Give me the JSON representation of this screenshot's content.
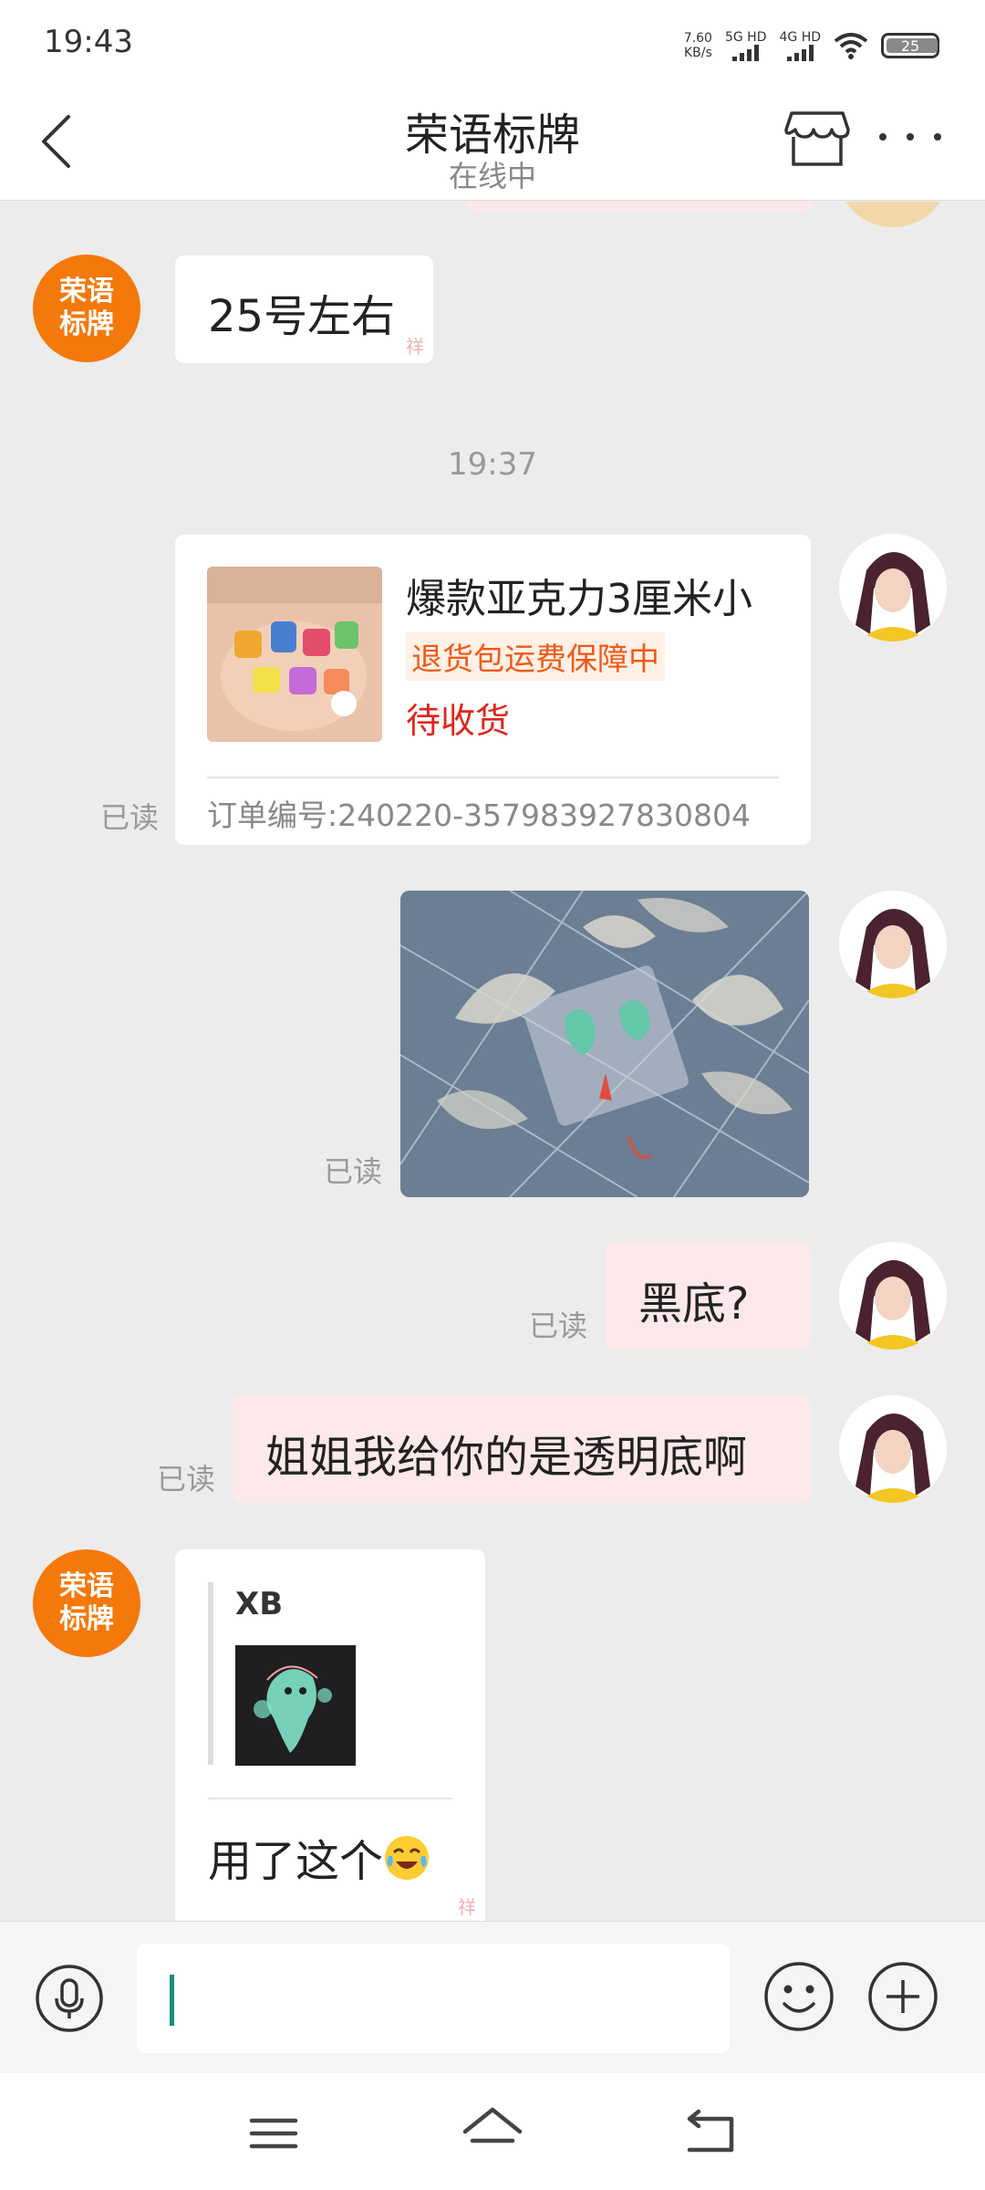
{
  "status_bar": {
    "time": "19:43",
    "speed_value": "7.60",
    "speed_unit": "KB/s",
    "sim1_label": "5G HD",
    "sim2_label": "4G HD",
    "battery": "25"
  },
  "header": {
    "title": "荣语标牌",
    "subtitle": "在线中"
  },
  "shop": {
    "avatar_text": "荣语\n标牌",
    "stamp_text": "祥"
  },
  "messages": {
    "m1_text": "25号左右",
    "timestamp": "19:37",
    "order": {
      "product_name": "爆款亚克力3厘米小",
      "tag": "退货包运费保障中",
      "status": "待收货",
      "order_no": "订单编号:240220-357983927830804"
    },
    "read_label": "已读",
    "m4_text": "黑底?",
    "m5_text": "姐姐我给你的是透明底啊",
    "quote_sender": "XB",
    "m6_text": "用了这个"
  },
  "icons": {
    "back": "chevron-left-icon",
    "shop": "store-icon",
    "more": "more-dots-icon",
    "mic": "microphone-icon",
    "emoji": "smiley-icon",
    "plus": "plus-circle-icon",
    "nav_menu": "menu-icon",
    "nav_home": "home-icon",
    "nav_back": "back-arrow-icon"
  },
  "colors": {
    "shop_orange": "#f5780a",
    "my_bubble": "#fde8ea",
    "tag_orange": "#f05a1a",
    "status_red": "#e0251b",
    "caret_teal": "#1a8c7e"
  }
}
